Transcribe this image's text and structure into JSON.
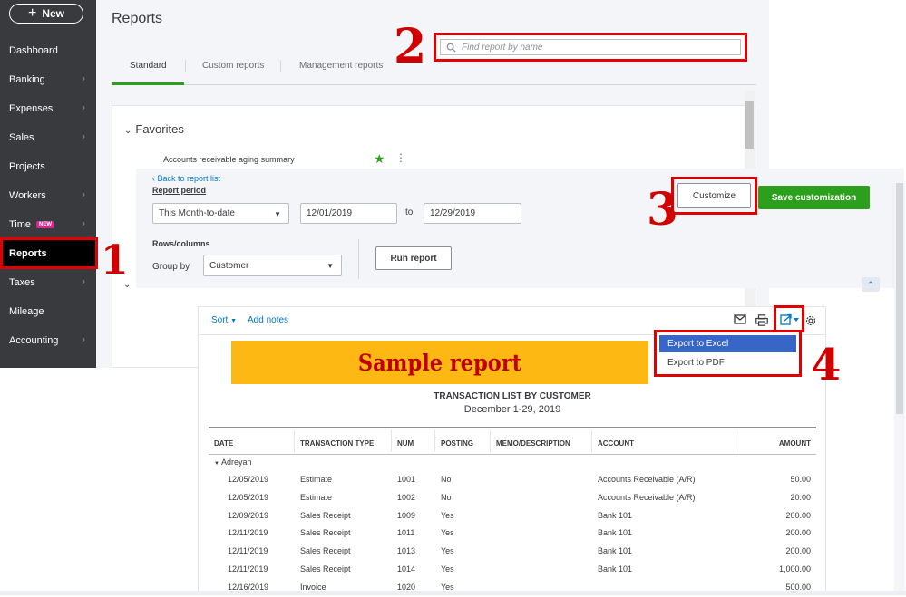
{
  "nav": {
    "new_label": "New",
    "items": [
      {
        "label": "Dashboard",
        "chevron": false
      },
      {
        "label": "Banking",
        "chevron": true
      },
      {
        "label": "Expenses",
        "chevron": true
      },
      {
        "label": "Sales",
        "chevron": true
      },
      {
        "label": "Projects",
        "chevron": false
      },
      {
        "label": "Workers",
        "chevron": true
      },
      {
        "label": "Time",
        "chevron": true,
        "badge": "NEW"
      },
      {
        "label": "Reports",
        "chevron": false,
        "active": true
      },
      {
        "label": "Taxes",
        "chevron": true
      },
      {
        "label": "Mileage",
        "chevron": false
      },
      {
        "label": "Accounting",
        "chevron": true
      }
    ]
  },
  "reports_page": {
    "title": "Reports",
    "tabs": [
      "Standard",
      "Custom reports",
      "Management reports"
    ],
    "search_placeholder": "Find report by name",
    "favorites_title": "Favorites",
    "favorite_item": "Accounts receivable aging summary"
  },
  "settings": {
    "back_link": "Back to report list",
    "report_period_label": "Report period",
    "period_value": "This Month-to-date",
    "start_date": "12/01/2019",
    "to_label": "to",
    "end_date": "12/29/2019",
    "rows_columns_label": "Rows/columns",
    "group_by_label": "Group by",
    "group_by_value": "Customer",
    "run_report": "Run report",
    "customize": "Customize",
    "save_customization": "Save customization"
  },
  "report": {
    "sort_label": "Sort",
    "add_notes": "Add notes",
    "banner": "Sample report",
    "title": "TRANSACTION LIST BY CUSTOMER",
    "date_range": "December 1-29, 2019",
    "columns": [
      "DATE",
      "TRANSACTION TYPE",
      "NUM",
      "POSTING",
      "MEMO/DESCRIPTION",
      "ACCOUNT",
      "AMOUNT"
    ],
    "group": "Adreyan",
    "rows": [
      {
        "date": "12/05/2019",
        "type": "Estimate",
        "num": "1001",
        "posting": "No",
        "memo": "",
        "account": "Accounts Receivable (A/R)",
        "amount": "50.00"
      },
      {
        "date": "12/05/2019",
        "type": "Estimate",
        "num": "1002",
        "posting": "No",
        "memo": "",
        "account": "Accounts Receivable (A/R)",
        "amount": "20.00"
      },
      {
        "date": "12/09/2019",
        "type": "Sales Receipt",
        "num": "1009",
        "posting": "Yes",
        "memo": "",
        "account": "Bank 101",
        "amount": "200.00"
      },
      {
        "date": "12/11/2019",
        "type": "Sales Receipt",
        "num": "1011",
        "posting": "Yes",
        "memo": "",
        "account": "Bank 101",
        "amount": "200.00"
      },
      {
        "date": "12/11/2019",
        "type": "Sales Receipt",
        "num": "1013",
        "posting": "Yes",
        "memo": "",
        "account": "Bank 101",
        "amount": "200.00"
      },
      {
        "date": "12/11/2019",
        "type": "Sales Receipt",
        "num": "1014",
        "posting": "Yes",
        "memo": "",
        "account": "Bank 101",
        "amount": "1,000.00"
      },
      {
        "date": "12/16/2019",
        "type": "Invoice",
        "num": "1020",
        "posting": "Yes",
        "memo": "",
        "account": "",
        "amount": "500.00"
      }
    ]
  },
  "export_menu": {
    "excel": "Export to Excel",
    "pdf": "Export to PDF"
  },
  "callouts": [
    "1",
    "2",
    "3",
    "4"
  ],
  "colors": {
    "accent_green": "#2ca01c",
    "callout_red": "#e00000",
    "banner_yellow": "#fdb813",
    "link_blue": "#0077c5",
    "nav_dark": "#393a3d"
  }
}
